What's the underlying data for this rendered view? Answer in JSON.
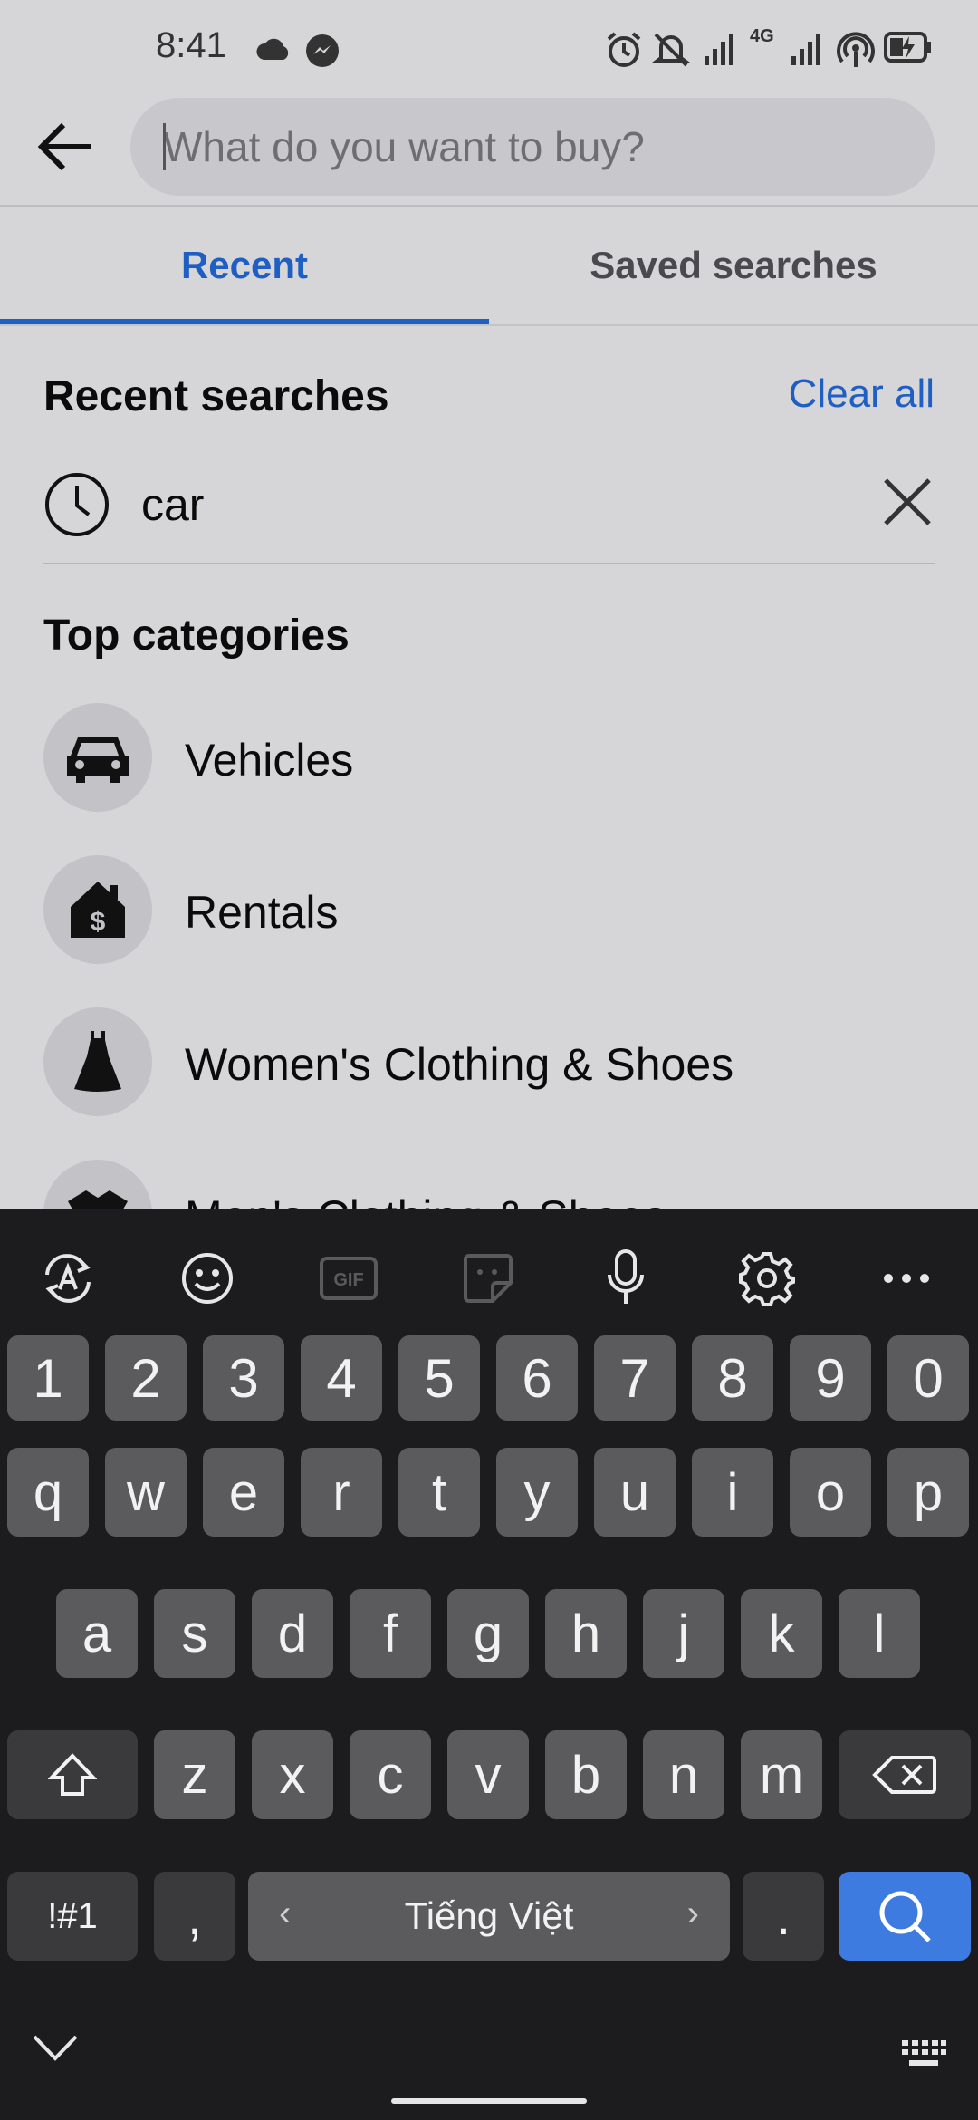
{
  "status_bar": {
    "time": "8:41",
    "network": "4G"
  },
  "header": {
    "search_placeholder": "What do you want to buy?"
  },
  "tabs": [
    {
      "label": "Recent"
    },
    {
      "label": "Saved searches"
    }
  ],
  "recent": {
    "title": "Recent searches",
    "clear_label": "Clear all",
    "items": [
      {
        "term": "car"
      }
    ]
  },
  "categories": {
    "title": "Top categories",
    "items": [
      {
        "label": "Vehicles",
        "icon": "car-icon"
      },
      {
        "label": "Rentals",
        "icon": "house-dollar-icon"
      },
      {
        "label": "Women's Clothing & Shoes",
        "icon": "dress-icon"
      },
      {
        "label": "Men's Clothing & Shoes",
        "icon": "shirt-icon"
      }
    ]
  },
  "keyboard": {
    "toolbar": [
      "translate-icon",
      "emoji-icon",
      "gif-icon",
      "sticker-icon",
      "microphone-icon",
      "settings-icon",
      "more-icon"
    ],
    "gif_label": "GIF",
    "numbers": [
      "1",
      "2",
      "3",
      "4",
      "5",
      "6",
      "7",
      "8",
      "9",
      "0"
    ],
    "row1": [
      "q",
      "w",
      "e",
      "r",
      "t",
      "y",
      "u",
      "i",
      "o",
      "p"
    ],
    "row2": [
      "a",
      "s",
      "d",
      "f",
      "g",
      "h",
      "j",
      "k",
      "l"
    ],
    "row3": [
      "z",
      "x",
      "c",
      "v",
      "b",
      "n",
      "m"
    ],
    "symbols_label": "!#1",
    "comma": ",",
    "space_label": "Tiếng Việt",
    "space_left": "‹",
    "space_right": "›",
    "period": ".",
    "accent_color": "#3d7be0"
  }
}
